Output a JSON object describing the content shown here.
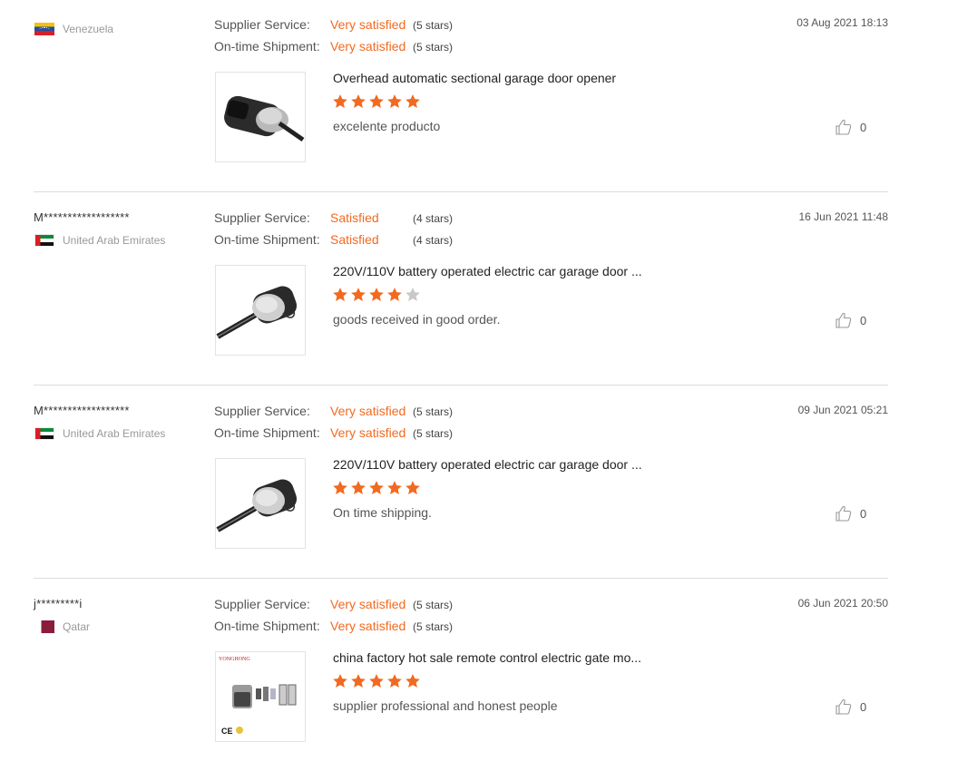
{
  "colors": {
    "accent": "#f26a20",
    "star_filled": "#f26a20",
    "star_empty": "#c8c8c8",
    "divider": "#dcdcdc"
  },
  "reviews": [
    {
      "buyer": "",
      "country": "Venezuela",
      "flag_icon": "venezuela-flag-icon",
      "supplier_service_label": "Supplier Service:",
      "supplier_service_value": "Very satisfied",
      "supplier_service_stars": "(5 stars)",
      "shipment_label": "On-time Shipment:",
      "shipment_value": "Very satisfied",
      "shipment_stars": "(5 stars)",
      "date": "03 Aug 2021 18:13",
      "product_title": "Overhead automatic sectional garage door opener",
      "rating": 5,
      "comment": "excelente producto",
      "likes": "0"
    },
    {
      "buyer": "M******************",
      "country": "United Arab Emirates",
      "flag_icon": "uae-flag-icon",
      "supplier_service_label": "Supplier Service:",
      "supplier_service_value": "Satisfied",
      "supplier_service_stars": "(4 stars)",
      "shipment_label": "On-time Shipment:",
      "shipment_value": "Satisfied",
      "shipment_stars": "(4 stars)",
      "date": "16 Jun 2021 11:48",
      "product_title": "220V/110V battery operated electric car garage door ...",
      "rating": 4,
      "comment": "goods received in good order.",
      "likes": "0"
    },
    {
      "buyer": "M******************",
      "country": "United Arab Emirates",
      "flag_icon": "uae-flag-icon",
      "supplier_service_label": "Supplier Service:",
      "supplier_service_value": "Very satisfied",
      "supplier_service_stars": "(5 stars)",
      "shipment_label": "On-time Shipment:",
      "shipment_value": "Very satisfied",
      "shipment_stars": "(5 stars)",
      "date": "09 Jun 2021 05:21",
      "product_title": "220V/110V battery operated electric car garage door ...",
      "rating": 5,
      "comment": "On time shipping.",
      "likes": "0"
    },
    {
      "buyer": "j*********i",
      "country": "Qatar",
      "flag_icon": "qatar-flag-icon",
      "supplier_service_label": "Supplier Service:",
      "supplier_service_value": "Very satisfied",
      "supplier_service_stars": "(5 stars)",
      "shipment_label": "On-time Shipment:",
      "shipment_value": "Very satisfied",
      "shipment_stars": "(5 stars)",
      "date": "06 Jun 2021 20:50",
      "product_title": "china factory hot sale remote control electric gate mo...",
      "rating": 5,
      "comment": "supplier professional and honest people",
      "likes": "0",
      "thumb_brand": "YONGHONG",
      "thumb_mark": "CE"
    }
  ]
}
